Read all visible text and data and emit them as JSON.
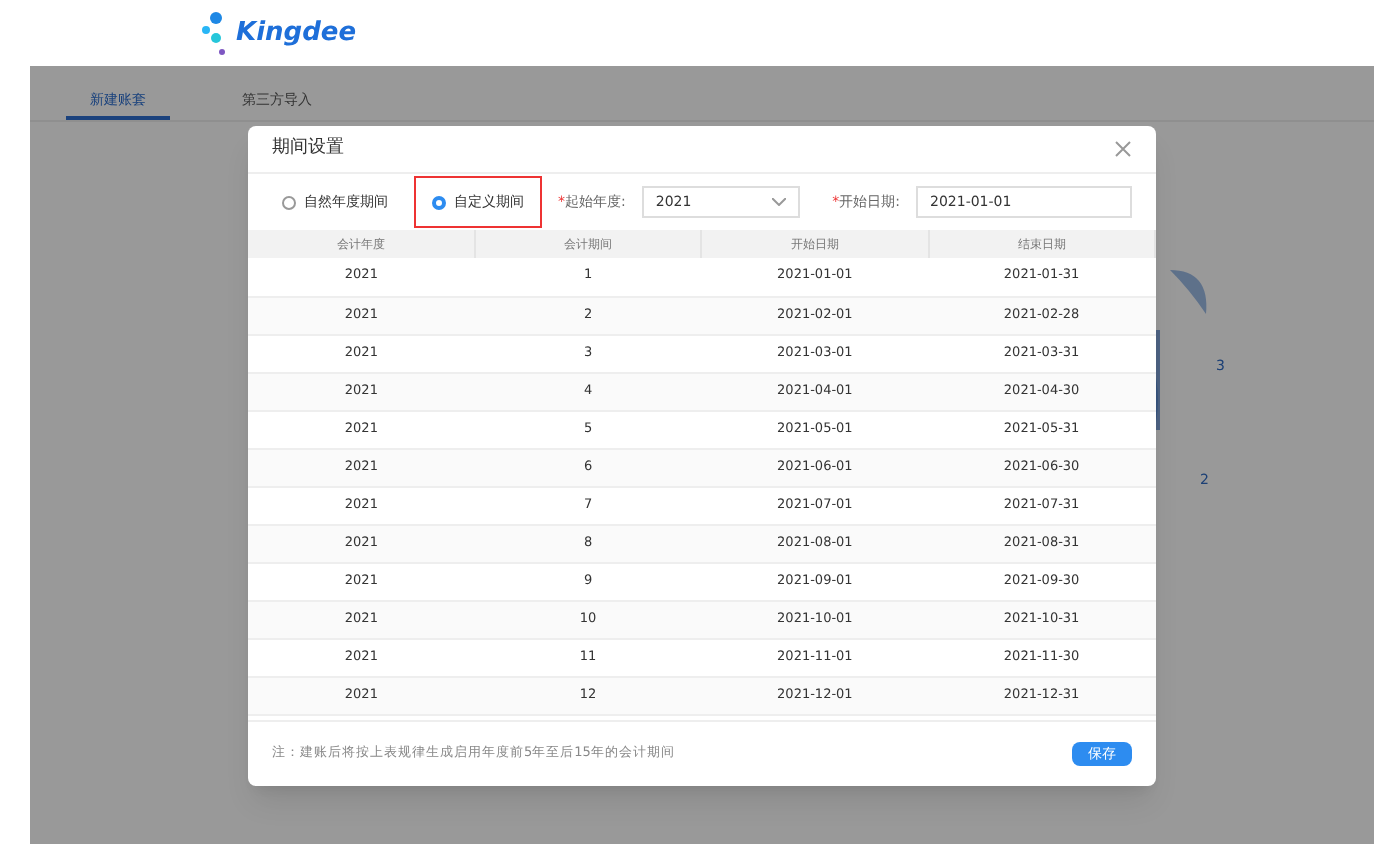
{
  "logo": {
    "text": "Kingdee"
  },
  "tabs": [
    {
      "label": "新建账套",
      "selected": true
    },
    {
      "label": "第三方导入",
      "selected": false
    }
  ],
  "illustration_marks": [
    "3",
    "2"
  ],
  "dialog": {
    "title": "期间设置",
    "period_options": [
      {
        "label": "自然年度期间",
        "selected": false
      },
      {
        "label": "自定义期间",
        "selected": true
      }
    ],
    "start_year": {
      "required_mark": "*",
      "label": "起始年度:",
      "value": "2021"
    },
    "start_date": {
      "required_mark": "*",
      "label": "开始日期:",
      "value": "2021-01-01"
    },
    "table": {
      "columns": [
        "会计年度",
        "会计期间",
        "开始日期",
        "结束日期"
      ],
      "rows": [
        [
          "2021",
          "1",
          "2021-01-01",
          "2021-01-31"
        ],
        [
          "2021",
          "2",
          "2021-02-01",
          "2021-02-28"
        ],
        [
          "2021",
          "3",
          "2021-03-01",
          "2021-03-31"
        ],
        [
          "2021",
          "4",
          "2021-04-01",
          "2021-04-30"
        ],
        [
          "2021",
          "5",
          "2021-05-01",
          "2021-05-31"
        ],
        [
          "2021",
          "6",
          "2021-06-01",
          "2021-06-30"
        ],
        [
          "2021",
          "7",
          "2021-07-01",
          "2021-07-31"
        ],
        [
          "2021",
          "8",
          "2021-08-01",
          "2021-08-31"
        ],
        [
          "2021",
          "9",
          "2021-09-01",
          "2021-09-30"
        ],
        [
          "2021",
          "10",
          "2021-10-01",
          "2021-10-31"
        ],
        [
          "2021",
          "11",
          "2021-11-01",
          "2021-11-30"
        ],
        [
          "2021",
          "12",
          "2021-12-01",
          "2021-12-31"
        ]
      ]
    },
    "note": "注：建账后将按上表规律生成启用年度前5年至后15年的会计期间",
    "save_button": "保存"
  }
}
